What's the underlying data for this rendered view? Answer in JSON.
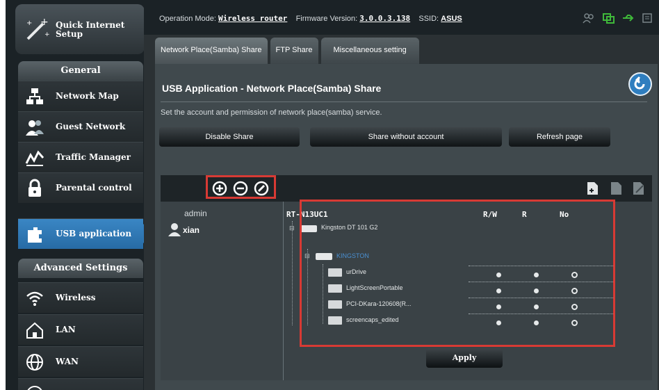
{
  "sidebar": {
    "quick_setup": "Quick Internet Setup",
    "general_header": "General",
    "general_items": [
      {
        "label": "Network Map",
        "icon": "network-map-icon"
      },
      {
        "label": "Guest Network",
        "icon": "guest-network-icon"
      },
      {
        "label": "Traffic Manager",
        "icon": "traffic-manager-icon"
      },
      {
        "label": "Parental control",
        "icon": "parental-control-icon"
      },
      {
        "label": "USB application",
        "icon": "usb-application-icon",
        "active": true
      }
    ],
    "advanced_header": "Advanced Settings",
    "advanced_items": [
      {
        "label": "Wireless",
        "icon": "wireless-icon"
      },
      {
        "label": "LAN",
        "icon": "lan-icon"
      },
      {
        "label": "WAN",
        "icon": "wan-icon"
      }
    ]
  },
  "topbar": {
    "op_mode_label": "Operation Mode:",
    "op_mode_value": "Wireless router",
    "fw_label": "Firmware Version:",
    "fw_value": "3.0.0.3.138",
    "ssid_label": "SSID:",
    "ssid_value": "ASUS"
  },
  "tabs": [
    "Network Place(Samba) Share",
    "FTP Share",
    "Miscellaneous setting"
  ],
  "page": {
    "title": "USB Application - Network Place(Samba) Share",
    "description": "Set the account and permission of network place(samba) service.",
    "buttons": {
      "disable": "Disable Share",
      "no_account": "Share without account",
      "refresh": "Refresh page"
    }
  },
  "accounts": {
    "header": "admin",
    "users": [
      "xian"
    ]
  },
  "tree": {
    "device": "RT-N13UC1",
    "columns": [
      "R/W",
      "R",
      "No"
    ],
    "drive": "Kingston DT 101 G2",
    "partition": "KINGSTON",
    "folders": [
      {
        "name": "urDrive",
        "permission": "No"
      },
      {
        "name": "LightScreenPortable",
        "permission": "No"
      },
      {
        "name": "PCI-DKara-120608(R...",
        "permission": "No"
      },
      {
        "name": "screencaps_edited",
        "permission": "No"
      }
    ]
  },
  "apply_label": "Apply",
  "colors": {
    "highlight": "#d83a34",
    "active_blue": "#2f79b8",
    "partition_text": "#4a8fd1"
  }
}
